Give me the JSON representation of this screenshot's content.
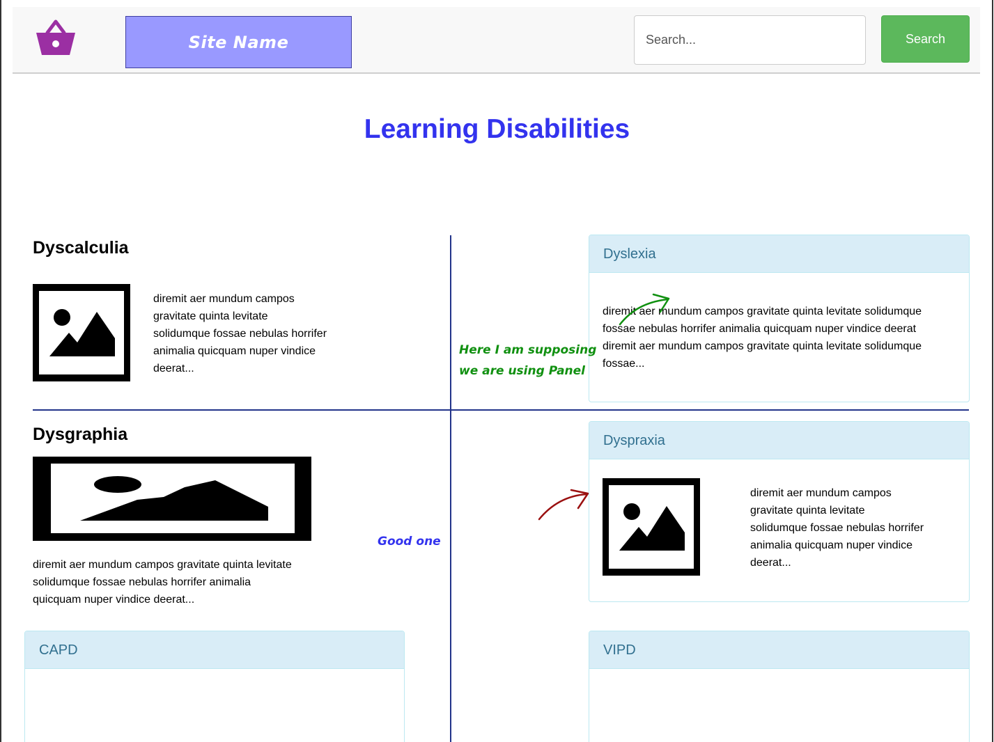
{
  "header": {
    "site_name": "Site Name",
    "search_placeholder": "Search...",
    "search_button": "Search"
  },
  "page": {
    "title": "Learning Disabilities"
  },
  "sections": {
    "dyscalculia": {
      "title": "Dyscalculia",
      "text": "diremit aer mundum campos gravitate quinta levitate solidumque fossae nebulas horrifer animalia quicquam nuper vindice deerat..."
    },
    "dysgraphia": {
      "title": "Dysgraphia",
      "text": "diremit aer mundum campos gravitate quinta levitate solidumque fossae nebulas horrifer animalia quicquam nuper vindice deerat..."
    }
  },
  "panels": {
    "dyslexia": {
      "title": "Dyslexia",
      "text": "diremit aer mundum campos gravitate quinta levitate solidumque fossae nebulas horrifer animalia quicquam nuper vindice deerat diremit aer mundum campos gravitate quinta levitate solidumque fossae..."
    },
    "dyspraxia": {
      "title": "Dyspraxia",
      "text": "diremit aer mundum campos gravitate quinta levitate solidumque fossae nebulas horrifer animalia quicquam nuper vindice deerat..."
    },
    "capd": {
      "title": "CAPD"
    },
    "vipd": {
      "title": "VIPD"
    }
  },
  "annotations": {
    "panel_note": "Here I am supposing we are using Panel",
    "good_note": "Good one"
  },
  "colors": {
    "title": "#3333ee",
    "site_name_bg": "#9999ff",
    "search_button": "#5cb85c",
    "panel_heading_bg": "#d9edf7",
    "panel_heading_text": "#31708f",
    "divider": "#22348a",
    "logo": "#9b2fa3",
    "note_green": "#109010",
    "note_red": "#9a1010"
  },
  "icons": {
    "logo": "shopping-basket-icon",
    "image": "image-placeholder-icon"
  }
}
